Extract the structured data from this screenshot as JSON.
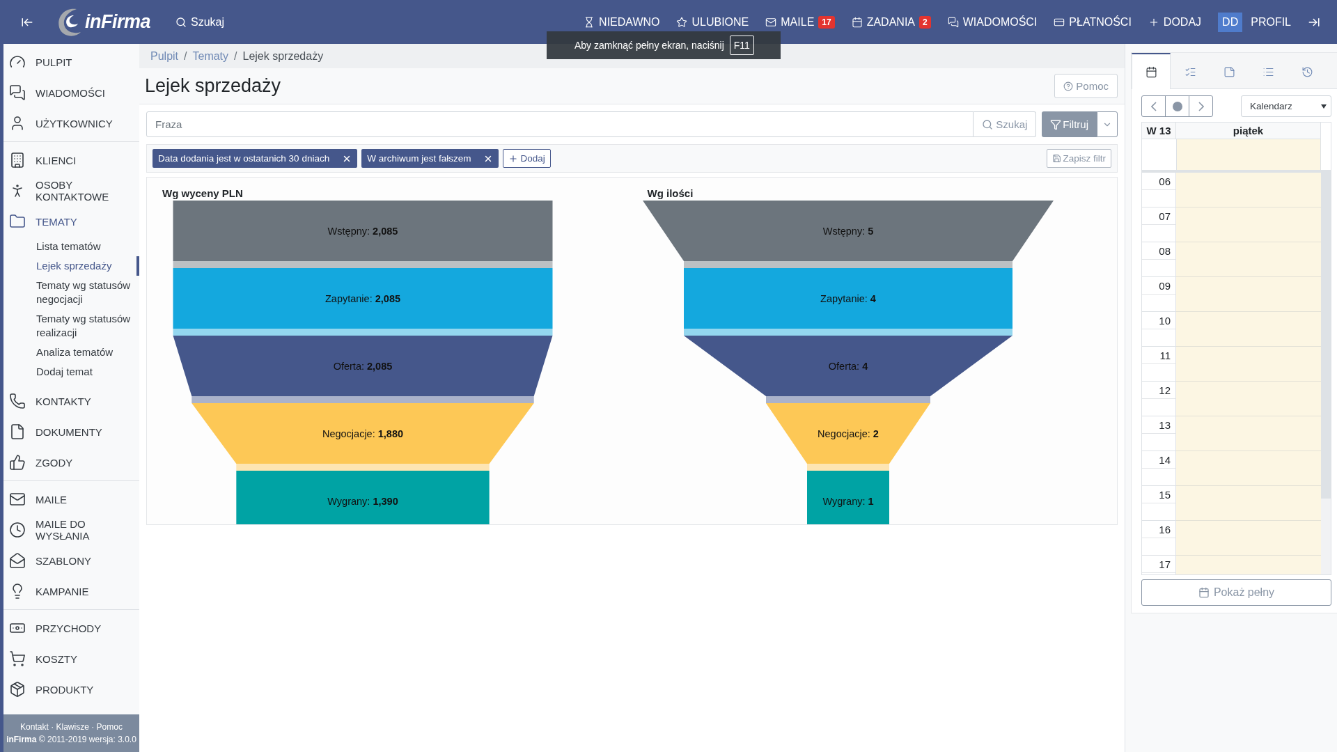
{
  "header": {
    "logo": "inFirma",
    "search_label": "Szukaj",
    "nav": [
      {
        "label": "NIEDAWNO"
      },
      {
        "label": "ULUBIONE"
      },
      {
        "label": "MAILE",
        "badge": "17"
      },
      {
        "label": "ZADANIA",
        "badge": "2"
      },
      {
        "label": "WIADOMOŚCI"
      },
      {
        "label": "PŁATNOŚCI"
      },
      {
        "label": "DODAJ"
      }
    ],
    "profile": {
      "initials": "DD",
      "label": "PROFIL"
    }
  },
  "toast": {
    "text": "Aby zamknąć pełny ekran, naciśnij",
    "key": "F11"
  },
  "sidebar": {
    "groups": [
      [
        {
          "label": "PULPIT",
          "selected": false
        },
        {
          "label": "WIADOMOŚCI",
          "selected": false
        },
        {
          "label": "UŻYTKOWNICY",
          "selected": false
        }
      ],
      [
        {
          "label": "KLIENCI",
          "selected": false
        },
        {
          "label": "OSOBY KONTAKTOWE",
          "selected": false
        },
        {
          "label": "TEMATY",
          "selected": true,
          "children": [
            {
              "label": "Lista tematów",
              "selected": false
            },
            {
              "label": "Lejek sprzedaży",
              "selected": true
            },
            {
              "label": "Tematy wg statusów negocjacji",
              "selected": false
            },
            {
              "label": "Tematy wg statusów realizacji",
              "selected": false
            },
            {
              "label": "Analiza tematów",
              "selected": false
            },
            {
              "label": "Dodaj temat",
              "selected": false
            }
          ]
        },
        {
          "label": "KONTAKTY",
          "selected": false
        },
        {
          "label": "DOKUMENTY",
          "selected": false
        },
        {
          "label": "ZGODY",
          "selected": false
        }
      ],
      [
        {
          "label": "MAILE",
          "selected": false
        },
        {
          "label": "MAILE DO WYSŁANIA",
          "selected": false
        },
        {
          "label": "SZABLONY",
          "selected": false
        },
        {
          "label": "KAMPANIE",
          "selected": false
        }
      ],
      [
        {
          "label": "PRZYCHODY",
          "selected": false
        },
        {
          "label": "KOSZTY",
          "selected": false
        },
        {
          "label": "PRODUKTY",
          "selected": false
        }
      ]
    ],
    "footer": {
      "links": [
        "Kontakt",
        "Klawisze",
        "Pomoc"
      ],
      "separator": "·",
      "brand": "inFirma",
      "copyright": "© 2011-2019 wersja: 3.0.0"
    }
  },
  "main": {
    "breadcrumb": [
      "Pulpit",
      "Tematy",
      "Lejek sprzedaży"
    ],
    "breadcrumb_separator": "/",
    "title": "Lejek sprzedaży",
    "help_button": "Pomoc",
    "search": {
      "placeholder": "Fraza",
      "search_button": "Szukaj",
      "filter_button": "Filtruj"
    },
    "filters": [
      {
        "label": "Data dodania jest w ostatanich 30 dniach"
      },
      {
        "label": "W archiwum jest fałszem"
      }
    ],
    "add_filter": "Dodaj",
    "save_filter": "Zapisz filtr",
    "funnels": [
      {
        "title": "Wg wyceny PLN",
        "stages": [
          {
            "name": "Wstępny:",
            "value": "2,085",
            "color": "#6c757d"
          },
          {
            "name": "Zapytanie:",
            "value": "2,085",
            "color": "#14a8de"
          },
          {
            "name": "Oferta:",
            "value": "2,085",
            "color": "#45578b"
          },
          {
            "name": "Negocjacje:",
            "value": "1,880",
            "color": "#fdc856"
          },
          {
            "name": "Wygrany:",
            "value": "1,390",
            "color": "#00a3a4"
          }
        ]
      },
      {
        "title": "Wg ilości",
        "stages": [
          {
            "name": "Wstępny:",
            "value": "5",
            "color": "#6c757d"
          },
          {
            "name": "Zapytanie:",
            "value": "4",
            "color": "#14a8de"
          },
          {
            "name": "Oferta:",
            "value": "4",
            "color": "#45578b"
          },
          {
            "name": "Negocjacje:",
            "value": "2",
            "color": "#fdc856"
          },
          {
            "name": "Wygrany:",
            "value": "1",
            "color": "#00a3a4"
          }
        ]
      }
    ]
  },
  "right_panel": {
    "tabs": [
      {
        "selected": true
      },
      {
        "selected": false
      },
      {
        "selected": false
      },
      {
        "selected": false
      },
      {
        "selected": false
      }
    ],
    "view_select": "Kalendarz",
    "week": "W 13",
    "day": "piątek",
    "hours": [
      "06",
      "07",
      "08",
      "09",
      "10",
      "11",
      "12",
      "13",
      "14",
      "15",
      "16",
      "17"
    ],
    "show_full_button": "Pokaż pełny"
  }
}
